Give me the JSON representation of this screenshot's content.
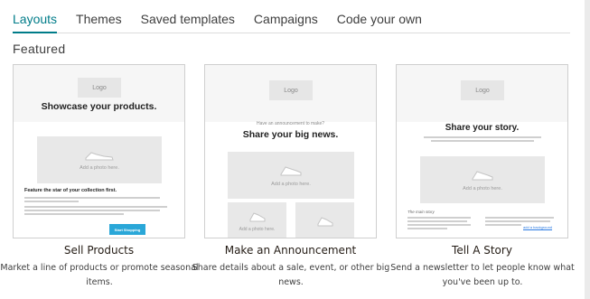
{
  "tabs": [
    {
      "label": "Layouts",
      "active": true
    },
    {
      "label": "Themes"
    },
    {
      "label": "Saved templates"
    },
    {
      "label": "Campaigns"
    },
    {
      "label": "Code your own"
    }
  ],
  "section_title": "Featured",
  "accent_color": "#007c89",
  "cards": [
    {
      "title": "Sell Products",
      "description": "Market a line of products or promote seasonal items.",
      "preview": {
        "logo": "Logo",
        "headline": "Showcase your products.",
        "photo_caption": "Add a photo here.",
        "body_title": "Feature the star of your collection first.",
        "button": "Start Shopping"
      }
    },
    {
      "title": "Make an Announcement",
      "description": "Share details about a sale, event, or other big news.",
      "preview": {
        "logo": "Logo",
        "kicker": "Have an announcement to make?",
        "headline": "Share your big news.",
        "photo_caption": "Add a photo here.",
        "small_caption": "Add a photo here."
      }
    },
    {
      "title": "Tell A Story",
      "description": "Send a newsletter to let people know what you've been up to.",
      "preview": {
        "logo": "Logo",
        "headline": "Share your story.",
        "photo_caption": "Add a photo here.",
        "section_label": "The main story",
        "link_text": "add a background"
      }
    }
  ]
}
